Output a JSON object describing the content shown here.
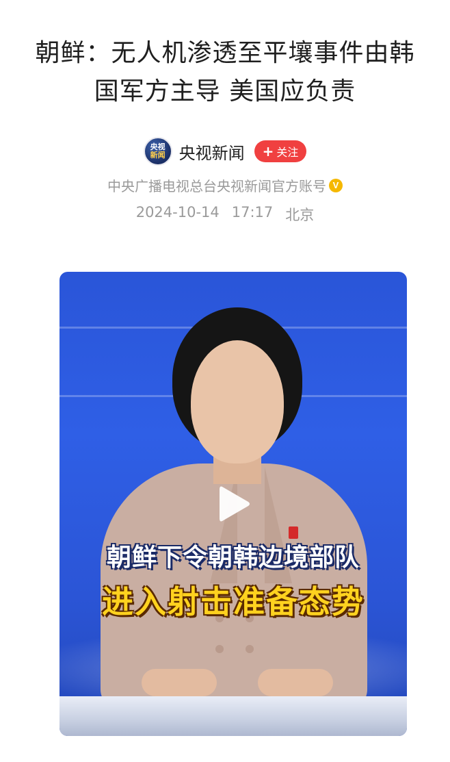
{
  "article": {
    "title_line1": "朝鲜：无人机渗透至平壤事件由韩",
    "title_line2": "国军方主导 美国应负责"
  },
  "author": {
    "avatar_line1": "央视",
    "avatar_line2": "新闻",
    "name": "央视新闻",
    "follow_label": "关注",
    "follow_plus": "+",
    "description": "中央广播电视总台央视新闻官方账号",
    "verified_mark": "V"
  },
  "meta": {
    "date": "2024-10-14",
    "time": "17:17",
    "location": "北京"
  },
  "video": {
    "caption_line1": "朝鲜下令朝韩边境部队",
    "caption_line2": "进入射击准备态势",
    "play_icon": "play-icon"
  },
  "colors": {
    "follow_bg": "#f04040",
    "video_bg": "#2f5fe6",
    "caption_yellow": "#ffd21f",
    "meta_gray": "#9a9a9a",
    "verified_gold": "#f5b800"
  }
}
